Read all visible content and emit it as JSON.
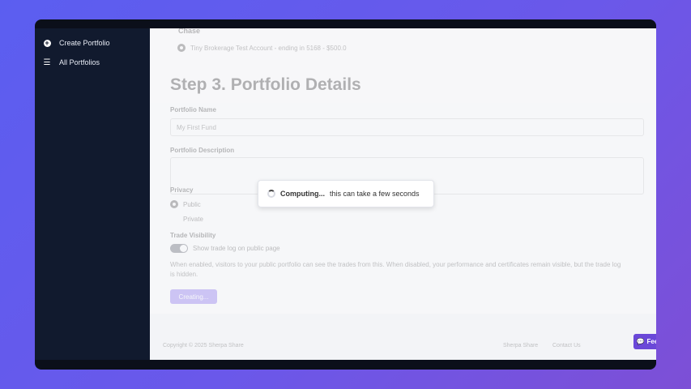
{
  "sidebar": {
    "items": [
      {
        "label": "Create Portfolio",
        "icon": "plus-circle-icon"
      },
      {
        "label": "All Portfolios",
        "icon": "list-icon"
      }
    ]
  },
  "form": {
    "broker_heading": "Chase",
    "account_option": "Tiny Brokerage Test Account - ending in 5168 - $500.0",
    "step_title": "Step 3. Portfolio Details",
    "name_label": "Portfolio Name",
    "name_value": "My First Fund",
    "description_label": "Portfolio Description",
    "privacy_label": "Privacy",
    "privacy_options": [
      "Public",
      "Private"
    ],
    "privacy_selected": "Public",
    "trade_visibility_label": "Trade Visibility",
    "trade_toggle_label": "Show trade log on public page",
    "trade_toggle_on": true,
    "help_text": "When enabled, visitors to your public portfolio can see the trades from this. When disabled, your performance and certificates remain visible, but the trade log is hidden.",
    "create_button": "Creating..."
  },
  "footer": {
    "copyright": "Copyright © 2025 Sherpa Share",
    "links": [
      "Sherpa Share",
      "Contact Us"
    ]
  },
  "feedback_button": "Feedback",
  "overlay": {
    "bold": "Computing...",
    "text": "this can take a few seconds"
  },
  "colors": {
    "background_gradient_start": "#5b5ef0",
    "sidebar_bg": "#111a2e",
    "accent_button": "#7b61f0",
    "feedback_bg": "#6a48d8"
  }
}
